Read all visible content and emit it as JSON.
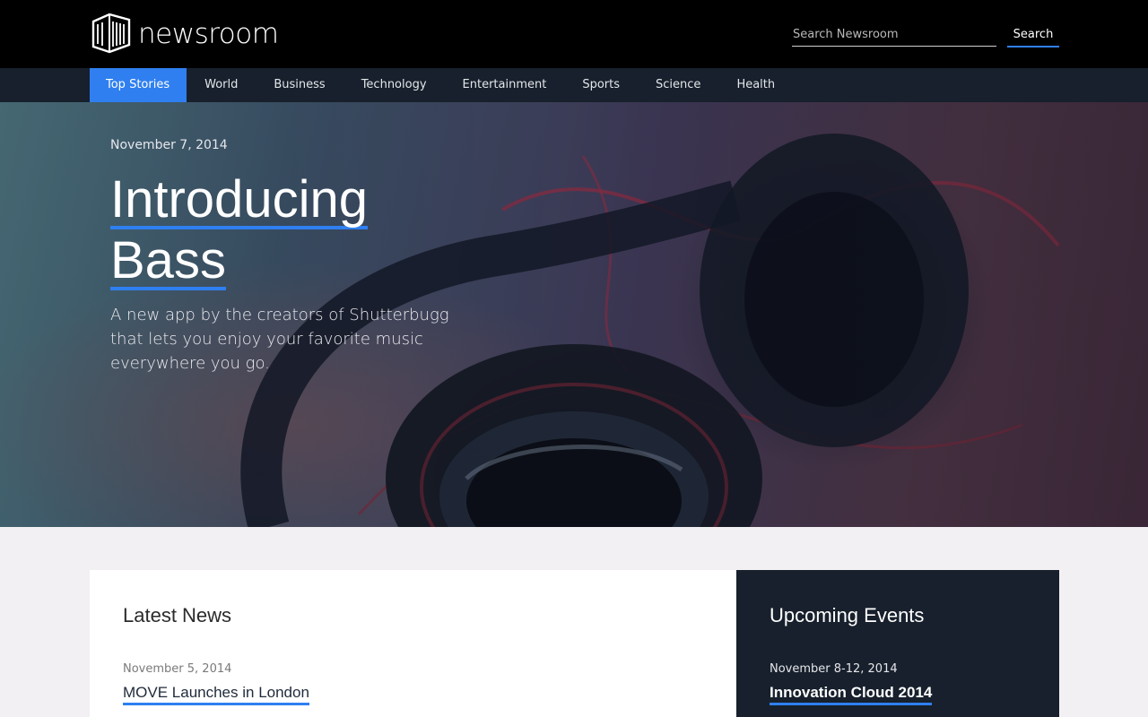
{
  "header": {
    "brand": "newsroom",
    "search_placeholder": "Search Newsroom",
    "search_button": "Search"
  },
  "nav": {
    "items": [
      {
        "label": "Top Stories",
        "active": true
      },
      {
        "label": "World"
      },
      {
        "label": "Business"
      },
      {
        "label": "Technology"
      },
      {
        "label": "Entertainment"
      },
      {
        "label": "Sports"
      },
      {
        "label": "Science"
      },
      {
        "label": "Health"
      }
    ]
  },
  "hero": {
    "date": "November 7, 2014",
    "title_line1": "Introducing",
    "title_line2": "Bass",
    "description": "A new app by the creators of Shutterbugg that lets you enjoy your favorite music everywhere you go."
  },
  "latest": {
    "heading": "Latest News",
    "items": [
      {
        "date": "November 5, 2014",
        "title": "MOVE Launches in London"
      }
    ]
  },
  "events": {
    "heading": "Upcoming Events",
    "items": [
      {
        "date": "November 8-12, 2014",
        "title": "Innovation Cloud 2014"
      }
    ]
  },
  "colors": {
    "accent": "#2f7ff0",
    "header_bg": "#000000",
    "nav_bg": "#17202c",
    "page_bg": "#f2f0f3"
  }
}
